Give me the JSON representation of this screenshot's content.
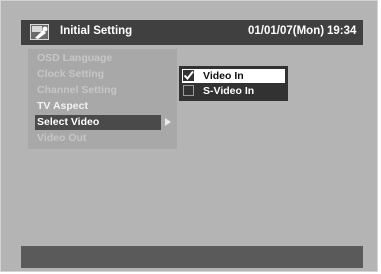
{
  "header": {
    "title": "Initial Setting",
    "date": "01/01/07(Mon)",
    "time": "19:34",
    "icon": "setup-wrench-icon"
  },
  "menu": {
    "items": [
      {
        "label": "OSD Language"
      },
      {
        "label": "Clock Setting"
      },
      {
        "label": "Channel Setting"
      },
      {
        "label": "TV Aspect"
      },
      {
        "label": "Select Video"
      },
      {
        "label": "Video Out"
      }
    ],
    "selected_label": "Select Video"
  },
  "options": [
    {
      "label": "Video In",
      "checked": true
    },
    {
      "label": "S-Video In",
      "checked": false
    }
  ],
  "colors": {
    "background": "#b4b4b4",
    "bar": "#404040",
    "highlight": "#4a4a4a"
  }
}
